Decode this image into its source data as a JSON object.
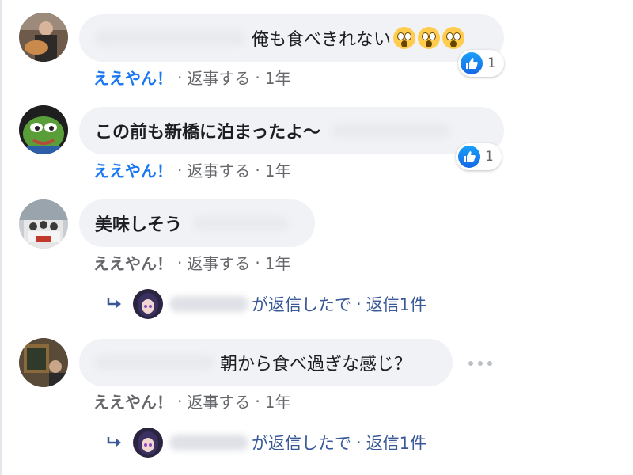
{
  "comments": [
    {
      "text": "俺も食べきれない",
      "reaction_count": "1",
      "like_label": "ええやん！",
      "reply_label": "返事する",
      "time": "1年"
    },
    {
      "text": "この前も新橋に泊まったよ〜",
      "reaction_count": "1",
      "like_label": "ええやん！",
      "reply_label": "返事する",
      "time": "1年"
    },
    {
      "text": "美味しそう",
      "like_label": "ええやん！",
      "reply_label": "返事する",
      "time": "1年",
      "reply_summary": {
        "text": "が返信したで",
        "count": "返信1件"
      }
    },
    {
      "text": "朝から食べ過ぎな感じ？",
      "like_label": "ええやん！",
      "reply_label": "返事する",
      "time": "1年",
      "reply_summary": {
        "text": "が返信したで",
        "count": "返信1件"
      }
    }
  ],
  "separator": "·",
  "colors": {
    "like_active": "#1877f2",
    "meta_text": "#65676b",
    "bubble_bg": "#f0f2f5",
    "reply_link": "#385898"
  },
  "icons": [
    "like-reaction-icon",
    "astonished-face-emoji",
    "reply-arrow-icon",
    "more-options-icon"
  ]
}
